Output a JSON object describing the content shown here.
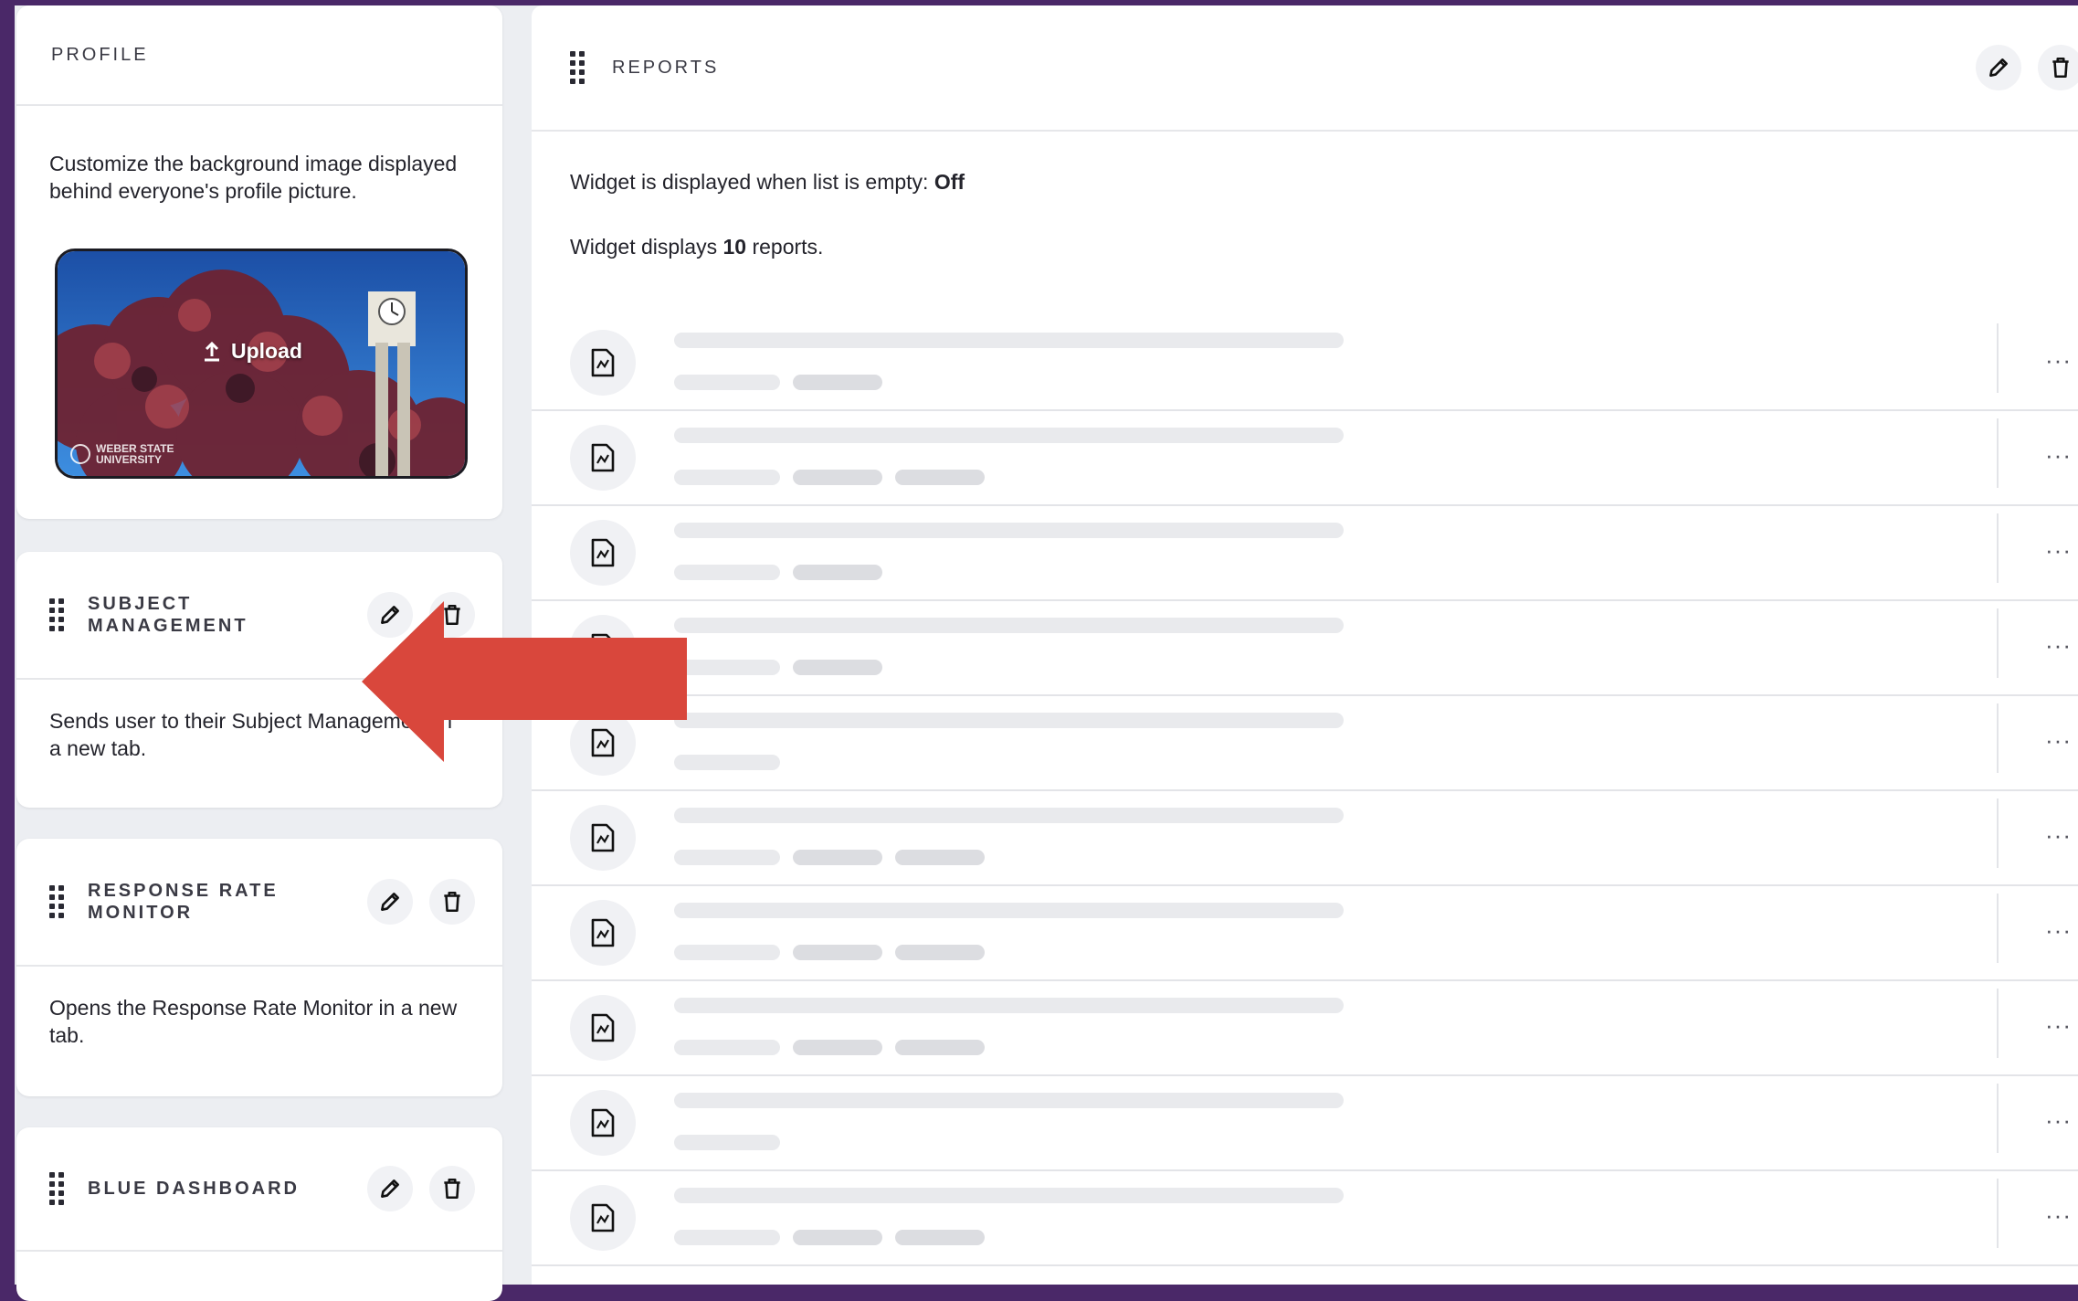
{
  "profile": {
    "title": "PROFILE",
    "description": "Customize the background image displayed behind everyone's profile picture.",
    "upload_label": "Upload",
    "watermark": "WEBER STATE UNIVERSITY"
  },
  "subject_management": {
    "title_line1": "SUBJECT",
    "title_line2": "MANAGEMENT",
    "description": "Sends user to their Subject Management in a new tab."
  },
  "response_rate": {
    "title_line1": "RESPONSE RATE",
    "title_line2": "MONITOR",
    "description": "Opens the Response Rate Monitor in a new tab."
  },
  "blue_dashboard": {
    "title": "BLUE DASHBOARD"
  },
  "reports": {
    "title": "REPORTS",
    "empty_label": "Widget is displayed when list is empty: ",
    "empty_value": "Off",
    "count_prefix": "Widget displays ",
    "count_value": "10",
    "count_suffix": " reports.",
    "more_label": "···",
    "rows": [
      {
        "chips": 2
      },
      {
        "chips": 3
      },
      {
        "chips": 2
      },
      {
        "chips": 2
      },
      {
        "chips": 1
      },
      {
        "chips": 3
      },
      {
        "chips": 3
      },
      {
        "chips": 3
      },
      {
        "chips": 1
      },
      {
        "chips": 3
      }
    ]
  },
  "colors": {
    "frame": "#4a2868",
    "arrow": "#d9473c"
  },
  "icons": [
    "drag-handle-icon",
    "pencil-icon",
    "trash-icon",
    "file-report-icon",
    "more-icon",
    "upload-icon"
  ]
}
